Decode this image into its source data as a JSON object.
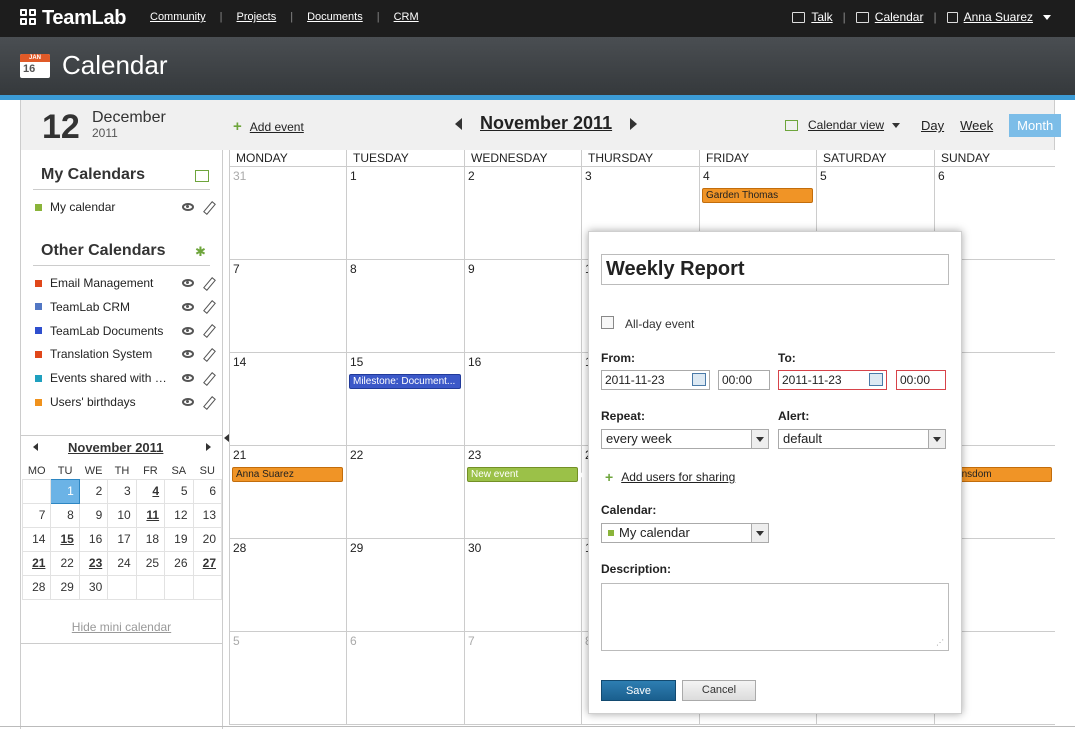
{
  "topbar": {
    "logo": "TeamLab",
    "nav": [
      "Community",
      "Projects",
      "Documents",
      "CRM"
    ],
    "talk": "Talk",
    "calendar": "Calendar",
    "user": "Anna Suarez"
  },
  "header": {
    "title": "Calendar",
    "icon_month": "JAN",
    "icon_day": "16"
  },
  "strip": {
    "day": "12",
    "month": "December",
    "year": "2011",
    "add_event": "Add event",
    "current": "November 2011",
    "calendar_view": "Calendar view",
    "modes": [
      "Day",
      "Week",
      "Month"
    ],
    "active_mode": "Month"
  },
  "sidebar": {
    "my_title": "My Calendars",
    "my_items": [
      {
        "label": "My calendar",
        "color": "#8ab43a"
      }
    ],
    "other_title": "Other Calendars",
    "other_items": [
      {
        "label": "Email Management",
        "color": "#e0471a"
      },
      {
        "label": "TeamLab CRM",
        "color": "#5277c4"
      },
      {
        "label": "TeamLab Documents",
        "color": "#2f4fce"
      },
      {
        "label": "Translation System",
        "color": "#e0471a"
      },
      {
        "label": "Events shared with …",
        "color": "#1fa0bf"
      },
      {
        "label": "Users' birthdays",
        "color": "#f0921c"
      }
    ]
  },
  "mini": {
    "title": "November 2011",
    "dow": [
      "MO",
      "TU",
      "WE",
      "TH",
      "FR",
      "SA",
      "SU"
    ],
    "weeks": [
      [
        "",
        "1",
        "2",
        "3",
        "4",
        "5",
        "6"
      ],
      [
        "7",
        "8",
        "9",
        "10",
        "11",
        "12",
        "13"
      ],
      [
        "14",
        "15",
        "16",
        "17",
        "18",
        "19",
        "20"
      ],
      [
        "21",
        "22",
        "23",
        "24",
        "25",
        "26",
        "27"
      ],
      [
        "28",
        "29",
        "30",
        "",
        "",
        "",
        ""
      ]
    ],
    "bold_days": [
      "4",
      "11",
      "15",
      "21",
      "23",
      "27"
    ],
    "selected": "1",
    "hide": "Hide mini calendar"
  },
  "grid": {
    "dow": [
      "MONDAY",
      "TUESDAY",
      "WEDNESDAY",
      "THURSDAY",
      "FRIDAY",
      "SATURDAY",
      "SUNDAY"
    ],
    "weeks": [
      [
        [
          "31",
          true
        ],
        [
          "1",
          false
        ],
        [
          "2",
          false
        ],
        [
          "3",
          false
        ],
        [
          "4",
          false
        ],
        [
          "5",
          false
        ],
        [
          "6",
          false
        ]
      ],
      [
        [
          "7",
          false
        ],
        [
          "8",
          false
        ],
        [
          "9",
          false
        ],
        [
          "1",
          false
        ],
        [
          "",
          false
        ],
        [
          "",
          false
        ],
        [
          "",
          false
        ]
      ],
      [
        [
          "14",
          false
        ],
        [
          "15",
          false
        ],
        [
          "16",
          false
        ],
        [
          "1",
          false
        ],
        [
          "",
          false
        ],
        [
          "",
          false
        ],
        [
          "",
          false
        ]
      ],
      [
        [
          "21",
          false
        ],
        [
          "22",
          false
        ],
        [
          "23",
          false
        ],
        [
          "2",
          false
        ],
        [
          "",
          false
        ],
        [
          "",
          false
        ],
        [
          "",
          false
        ]
      ],
      [
        [
          "28",
          false
        ],
        [
          "29",
          false
        ],
        [
          "30",
          false
        ],
        [
          "1",
          false
        ],
        [
          "",
          false
        ],
        [
          "",
          false
        ],
        [
          "",
          false
        ]
      ],
      [
        [
          "5",
          true
        ],
        [
          "6",
          true
        ],
        [
          "7",
          true
        ],
        [
          "8",
          true
        ],
        [
          "",
          false
        ],
        [
          "",
          false
        ],
        [
          "",
          false
        ]
      ]
    ],
    "events": [
      {
        "label": "Garden Thomas",
        "week": 0,
        "day": 4,
        "style": "orange"
      },
      {
        "label": "Milestone: Document...",
        "week": 2,
        "day": 1,
        "style": "blue"
      },
      {
        "label": "Anna Suarez",
        "week": 3,
        "day": 0,
        "style": "orange"
      },
      {
        "label": "New event",
        "week": 3,
        "day": 2,
        "style": "green"
      },
      {
        "label": "lin Linsdom",
        "week": 3,
        "day": 6,
        "style": "orange"
      }
    ]
  },
  "popup": {
    "title": "Weekly Report",
    "allday": "All-day event",
    "from_label": "From:",
    "to_label": "To:",
    "from_date": "2011-11-23",
    "from_time": "00:00",
    "to_date": "2011-11-23",
    "to_time": "00:00",
    "repeat_label": "Repeat:",
    "repeat_value": "every week",
    "alert_label": "Alert:",
    "alert_value": "default",
    "share": "Add users for sharing",
    "calendar_label": "Calendar:",
    "calendar_value": "My calendar",
    "description_label": "Description:",
    "save": "Save",
    "cancel": "Cancel"
  }
}
